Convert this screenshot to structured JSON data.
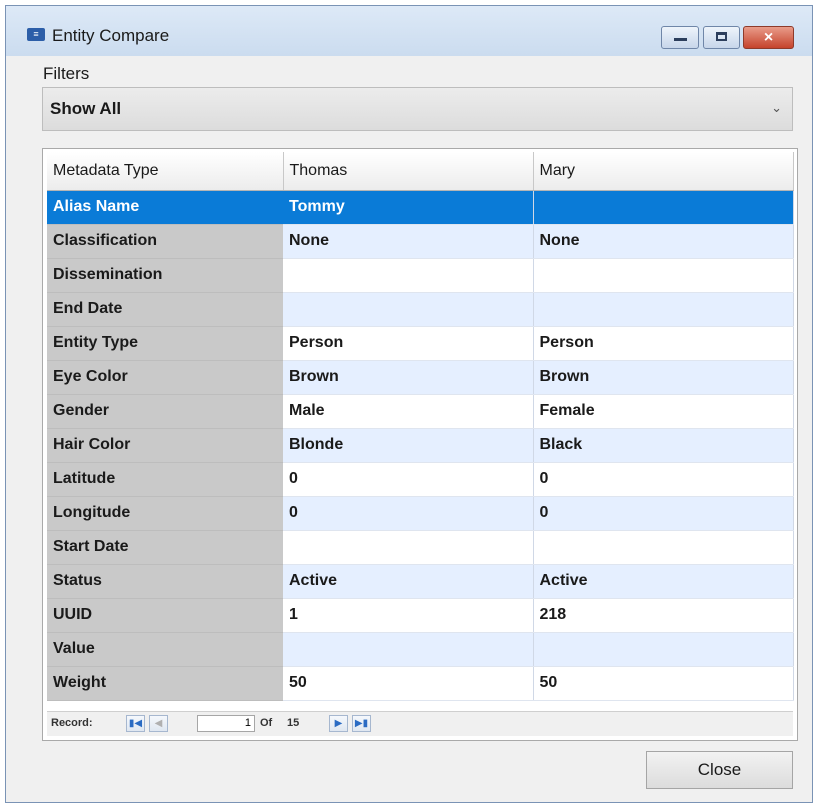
{
  "window": {
    "title": "Entity Compare",
    "icon": "entity-compare-icon",
    "controls": {
      "minimize": "minimize-icon",
      "maximize": "maximize-icon",
      "close": "×"
    }
  },
  "filters": {
    "label": "Filters",
    "selected": "Show All"
  },
  "grid": {
    "columns": [
      "Metadata Type",
      "Thomas",
      "Mary"
    ],
    "selected_row": 0,
    "rows": [
      {
        "type": "Alias Name",
        "a": "Tommy",
        "b": ""
      },
      {
        "type": "Classification",
        "a": "None",
        "b": "None"
      },
      {
        "type": "Dissemination",
        "a": "",
        "b": ""
      },
      {
        "type": "End Date",
        "a": "",
        "b": ""
      },
      {
        "type": "Entity Type",
        "a": "Person",
        "b": "Person"
      },
      {
        "type": "Eye Color",
        "a": "Brown",
        "b": "Brown"
      },
      {
        "type": "Gender",
        "a": "Male",
        "b": "Female"
      },
      {
        "type": "Hair Color",
        "a": "Blonde",
        "b": "Black"
      },
      {
        "type": "Latitude",
        "a": "0",
        "b": "0"
      },
      {
        "type": "Longitude",
        "a": "0",
        "b": "0"
      },
      {
        "type": "Start Date",
        "a": "",
        "b": ""
      },
      {
        "type": "Status",
        "a": "Active",
        "b": "Active"
      },
      {
        "type": "UUID",
        "a": "1",
        "b": "218"
      },
      {
        "type": "Value",
        "a": "",
        "b": ""
      },
      {
        "type": "Weight",
        "a": "50",
        "b": "50"
      }
    ]
  },
  "navigator": {
    "label": "Record:",
    "current": "1",
    "of": "Of",
    "total": "15"
  },
  "buttons": {
    "close": "Close"
  },
  "colors": {
    "selection": "#0a7bd7",
    "alt_row": "#e5efff",
    "header_col": "#c9c9c9"
  }
}
